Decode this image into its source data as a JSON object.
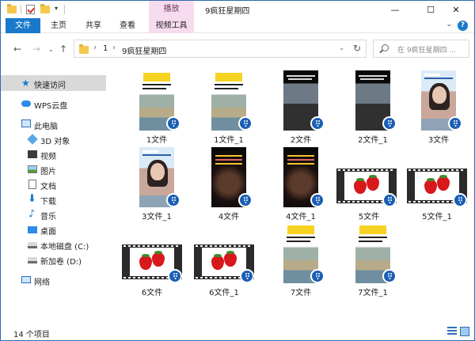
{
  "window": {
    "title": "9疯狂星期四",
    "minimize_icon": "minimize-icon",
    "maximize_icon": "maximize-icon",
    "close_icon": "close-icon"
  },
  "ribbon": {
    "context_group": "播放",
    "tabs": [
      {
        "label": "文件"
      },
      {
        "label": "主页"
      },
      {
        "label": "共享"
      },
      {
        "label": "查看"
      },
      {
        "label": "视频工具"
      }
    ]
  },
  "address": {
    "crumbs": [
      "1",
      "9疯狂星期四"
    ],
    "search_placeholder": "在 9疯狂星期四 ..."
  },
  "sidebar": {
    "items": [
      {
        "label": "快速访问",
        "icon": "star-icon"
      },
      {
        "label": "WPS云盘",
        "icon": "cloud-icon"
      },
      {
        "label": "此电脑",
        "icon": "computer-icon"
      },
      {
        "label": "3D 对象",
        "icon": "cube-icon"
      },
      {
        "label": "视频",
        "icon": "video-icon"
      },
      {
        "label": "图片",
        "icon": "picture-icon"
      },
      {
        "label": "文档",
        "icon": "document-icon"
      },
      {
        "label": "下载",
        "icon": "download-icon"
      },
      {
        "label": "音乐",
        "icon": "music-icon"
      },
      {
        "label": "桌面",
        "icon": "desktop-icon"
      },
      {
        "label": "本地磁盘 (C:)",
        "icon": "drive-icon"
      },
      {
        "label": "新加卷 (D:)",
        "icon": "drive-icon"
      },
      {
        "label": "网络",
        "icon": "network-icon"
      }
    ]
  },
  "files": [
    {
      "name": "1文件",
      "thumb": "news"
    },
    {
      "name": "1文件_1",
      "thumb": "news"
    },
    {
      "name": "2文件",
      "thumb": "dark"
    },
    {
      "name": "2文件_1",
      "thumb": "dark"
    },
    {
      "name": "3文件",
      "thumb": "girl"
    },
    {
      "name": "3文件_1",
      "thumb": "girl"
    },
    {
      "name": "4文件",
      "thumb": "horror"
    },
    {
      "name": "4文件_1",
      "thumb": "horror"
    },
    {
      "name": "5文件",
      "thumb": "film"
    },
    {
      "name": "5文件_1",
      "thumb": "film"
    },
    {
      "name": "6文件",
      "thumb": "film"
    },
    {
      "name": "6文件_1",
      "thumb": "film"
    },
    {
      "name": "7文件",
      "thumb": "news"
    },
    {
      "name": "7文件_1",
      "thumb": "news"
    }
  ],
  "status": {
    "item_count": "14 个项目"
  },
  "colors": {
    "accent": "#1979ca",
    "context_tab": "#f7dbee",
    "selected_nav": "#d9d9d9",
    "badge": "#1a5fb4"
  }
}
